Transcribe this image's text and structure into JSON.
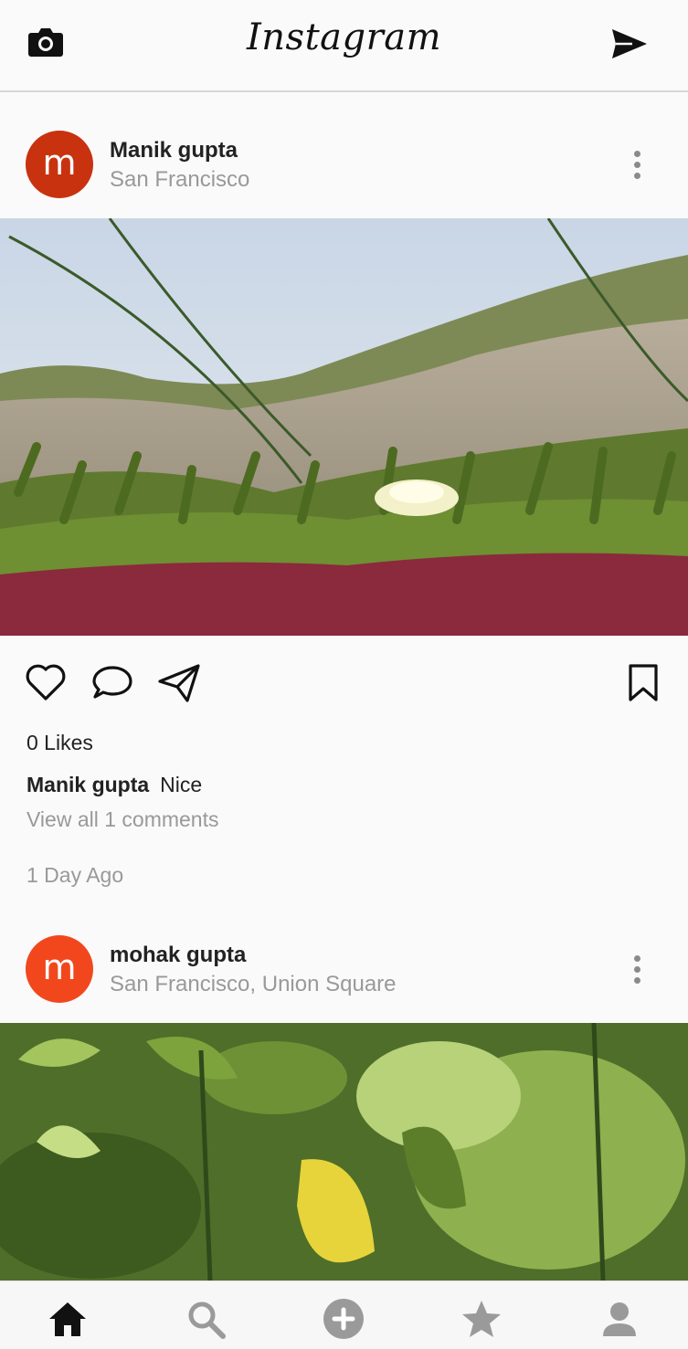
{
  "app": {
    "title": "Instagram"
  },
  "topbar": {
    "left_icon": "camera-icon",
    "right_icon": "send-icon"
  },
  "posts": [
    {
      "avatar_letter": "m",
      "avatar_color": "#c8320f",
      "author": "Manik gupta",
      "location": "San Francisco",
      "likes_text": "0 Likes",
      "caption_author": "Manik gupta",
      "caption_text": "Nice",
      "view_comments": "View all 1 comments",
      "time_ago": "1 Day Ago"
    },
    {
      "avatar_letter": "m",
      "avatar_color": "#f2471d",
      "author": "mohak gupta",
      "location": "San Francisco, Union Square"
    }
  ],
  "tabbar": {
    "items": [
      "home-icon",
      "search-icon",
      "add-icon",
      "star-icon",
      "profile-icon"
    ]
  }
}
